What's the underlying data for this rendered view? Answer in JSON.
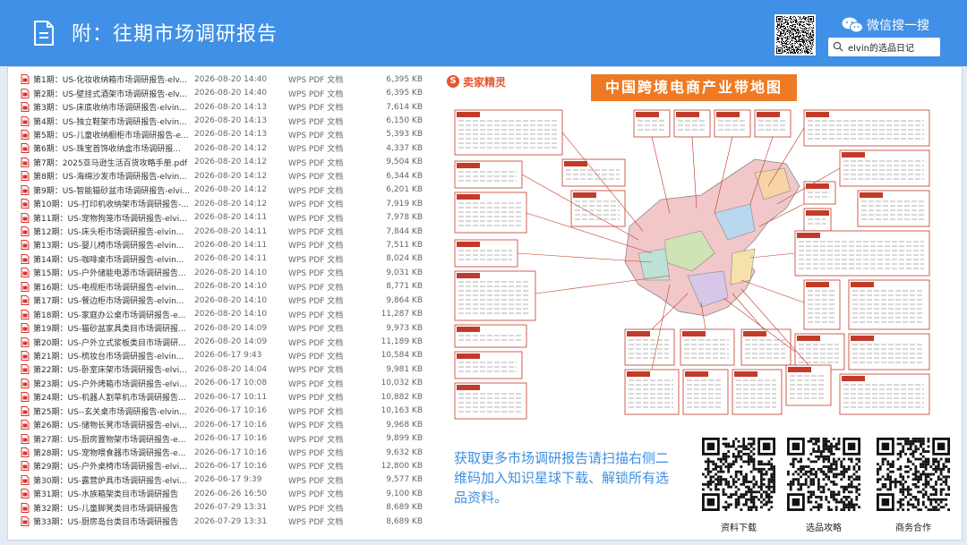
{
  "header": {
    "title": "附：往期市场调研报告",
    "wechat_label": "微信搜一搜",
    "search_text": "elvin的选品日记",
    "icons": {
      "doc": "document-icon",
      "wechat": "wechat-icon",
      "search": "search-icon"
    }
  },
  "files": [
    {
      "name": "第1期：US-化妆收纳箱市场调研报告-elv...",
      "date": "2026-08-20 14:40",
      "type": "WPS PDF 文档",
      "size": "6,395 KB"
    },
    {
      "name": "第2期：US-壁挂式酒架市场调研报告-elv...",
      "date": "2026-08-20 14:40",
      "type": "WPS PDF 文档",
      "size": "6,395 KB"
    },
    {
      "name": "第3期：US-床底收纳市场调研报告-elvin...",
      "date": "2026-08-20 14:13",
      "type": "WPS PDF 文档",
      "size": "7,614 KB"
    },
    {
      "name": "第4期：US-独立鞋架市场调研报告-elvin...",
      "date": "2026-08-20 14:13",
      "type": "WPS PDF 文档",
      "size": "6,150 KB"
    },
    {
      "name": "第5期：US-儿童收纳橱柜市场调研报告-e...",
      "date": "2026-08-20 14:13",
      "type": "WPS PDF 文档",
      "size": "5,393 KB"
    },
    {
      "name": "第6期：US-珠宝首饰收纳盒市场调研报...",
      "date": "2026-08-20 14:12",
      "type": "WPS PDF 文档",
      "size": "4,337 KB"
    },
    {
      "name": "第7期：2025亚马逊生活百货攻略手册.pdf",
      "date": "2026-08-20 14:12",
      "type": "WPS PDF 文档",
      "size": "9,504 KB"
    },
    {
      "name": "第8期：US-海绵沙发市场调研报告-elvin...",
      "date": "2026-08-20 14:12",
      "type": "WPS PDF 文档",
      "size": "6,344 KB"
    },
    {
      "name": "第9期：US-智能猫砂盆市场调研报告-elvi...",
      "date": "2026-08-20 14:12",
      "type": "WPS PDF 文档",
      "size": "6,201 KB"
    },
    {
      "name": "第10期：US-打印机收纳架市场调研报告-...",
      "date": "2026-08-20 14:12",
      "type": "WPS PDF 文档",
      "size": "7,919 KB"
    },
    {
      "name": "第11期：US-宠物狗笼市场调研报告-elvi...",
      "date": "2026-08-20 14:11",
      "type": "WPS PDF 文档",
      "size": "7,978 KB"
    },
    {
      "name": "第12期：US-床头柜市场调研报告-elvin...",
      "date": "2026-08-20 14:11",
      "type": "WPS PDF 文档",
      "size": "7,844 KB"
    },
    {
      "name": "第13期：US-婴儿椅市场调研报告-elvin...",
      "date": "2026-08-20 14:11",
      "type": "WPS PDF 文档",
      "size": "7,511 KB"
    },
    {
      "name": "第14期：US-咖啡桌市场调研报告-elvin...",
      "date": "2026-08-20 14:11",
      "type": "WPS PDF 文档",
      "size": "8,024 KB"
    },
    {
      "name": "第15期：US-户外储能电源市场调研报告...",
      "date": "2026-08-20 14:10",
      "type": "WPS PDF 文档",
      "size": "9,031 KB"
    },
    {
      "name": "第16期：US-电视柜市场调研报告-elvin...",
      "date": "2026-08-20 14:10",
      "type": "WPS PDF 文档",
      "size": "8,771 KB"
    },
    {
      "name": "第17期：US-餐边柜市场调研报告-elvin...",
      "date": "2026-08-20 14:10",
      "type": "WPS PDF 文档",
      "size": "9,864 KB"
    },
    {
      "name": "第18期：US-家庭办公桌市场调研报告-e...",
      "date": "2026-08-20 14:10",
      "type": "WPS PDF 文档",
      "size": "11,287 KB"
    },
    {
      "name": "第19期：US-猫砂盆家具类目市场调研报...",
      "date": "2026-08-20 14:09",
      "type": "WPS PDF 文档",
      "size": "9,973 KB"
    },
    {
      "name": "第20期：US-户外立式浆板类目市场调研...",
      "date": "2026-08-20 14:09",
      "type": "WPS PDF 文档",
      "size": "11,189 KB"
    },
    {
      "name": "第21期：US-梳妆台市场调研报告-elvin...",
      "date": "2026-06-17 9:43",
      "type": "WPS PDF 文档",
      "size": "10,584 KB"
    },
    {
      "name": "第22期：US-卧室床架市场调研报告-elvi...",
      "date": "2026-08-20 14:04",
      "type": "WPS PDF 文档",
      "size": "9,981 KB"
    },
    {
      "name": "第23期：US-户外烤箱市场调研报告-elvi...",
      "date": "2026-06-17 10:08",
      "type": "WPS PDF 文档",
      "size": "10,032 KB"
    },
    {
      "name": "第24期：US-机器人割草机市场调研报告...",
      "date": "2026-06-17 10:11",
      "type": "WPS PDF 文档",
      "size": "10,882 KB"
    },
    {
      "name": "第25期：US--玄关桌市场调研报告-elvin...",
      "date": "2026-06-17 10:16",
      "type": "WPS PDF 文档",
      "size": "10,163 KB"
    },
    {
      "name": "第26期：US-储物长凳市场调研报告-elvi...",
      "date": "2026-06-17 10:16",
      "type": "WPS PDF 文档",
      "size": "9,968 KB"
    },
    {
      "name": "第27期：US-厨房置物架市场调研报告-e...",
      "date": "2026-06-17 10:16",
      "type": "WPS PDF 文档",
      "size": "9,899 KB"
    },
    {
      "name": "第28期：US-宠物喂食器市场调研报告-e...",
      "date": "2026-06-17 10:16",
      "type": "WPS PDF 文档",
      "size": "9,632 KB"
    },
    {
      "name": "第29期：US-户外桌椅市场调研报告-elvi...",
      "date": "2026-06-17 10:16",
      "type": "WPS PDF 文档",
      "size": "12,800 KB"
    },
    {
      "name": "第30期：US-露营炉具市场调研报告-elvi...",
      "date": "2026-06-17 9:39",
      "type": "WPS PDF 文档",
      "size": "9,577 KB"
    },
    {
      "name": "第31期：US-水族箱架类目市场调研报告",
      "date": "2026-06-26 16:50",
      "type": "WPS PDF 文档",
      "size": "9,100 KB"
    },
    {
      "name": "第32期：US-儿童脚凳类目市场调研报告",
      "date": "2026-07-29 13:31",
      "type": "WPS PDF 文档",
      "size": "8,689 KB"
    },
    {
      "name": "第33期：US-厨房岛台类目市场调研报告",
      "date": "2026-07-29 13:31",
      "type": "WPS PDF 文档",
      "size": "8,689 KB"
    }
  ],
  "brand": {
    "mark": "S",
    "name": "卖家精灵"
  },
  "map": {
    "title": "中国跨境电商产业带地图",
    "icon": "china-map-icon"
  },
  "promo": {
    "text": "获取更多市场调研报告请扫描右侧二维码加入知识星球下载、解锁所有选品资料。"
  },
  "qr_codes": [
    {
      "caption": "资料下载"
    },
    {
      "caption": "选品攻略"
    },
    {
      "caption": "商务合作"
    }
  ],
  "colors": {
    "header": "#3f90e6",
    "accent_orange": "#ee7b23",
    "promo_blue": "#3f8fe0",
    "pdf_red": "#d9342b"
  }
}
